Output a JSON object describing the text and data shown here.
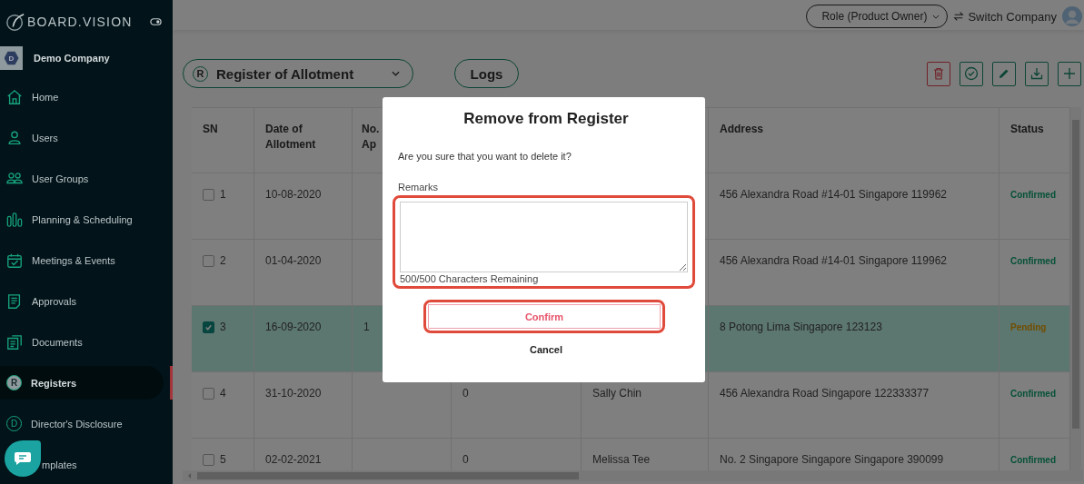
{
  "sidebar": {
    "brand": "BOARD.VISION",
    "company": {
      "badge": "D",
      "name": "Demo Company"
    },
    "items": [
      {
        "label": "Home",
        "kind": "home",
        "selected": false
      },
      {
        "label": "Users",
        "kind": "user",
        "selected": false
      },
      {
        "label": "User Groups",
        "kind": "users",
        "selected": false
      },
      {
        "label": "Planning & Scheduling",
        "kind": "bars",
        "selected": false
      },
      {
        "label": "Meetings & Events",
        "kind": "calendar",
        "selected": false
      },
      {
        "label": "Approvals",
        "kind": "document",
        "selected": false
      },
      {
        "label": "Documents",
        "kind": "documents",
        "selected": false
      },
      {
        "label": "Registers",
        "kind": "letter",
        "icon_letter": "R",
        "selected": true
      },
      {
        "label": "Director's Disclosure",
        "kind": "letter",
        "icon_letter": "D",
        "selected": false
      },
      {
        "label": "mplates",
        "kind": "covered",
        "selected": false
      }
    ]
  },
  "top_bar": {
    "role": "Role (Product Owner)",
    "switch_company": "Switch Company"
  },
  "register_select": {
    "badge": "R",
    "label": "Register of Allotment"
  },
  "logs_button": "Logs",
  "table": {
    "columns": [
      {
        "label": "SN"
      },
      {
        "label": "Date of Allotment"
      },
      {
        "label": "No. Ap"
      },
      {
        "label": "Address"
      },
      {
        "label": "Status"
      }
    ],
    "rows": [
      {
        "sn": "1",
        "checked": false,
        "selected": false,
        "date": "10-08-2020",
        "address": "456 Alexandra Road #14-01 Singapore 119962",
        "status": "Confirmed",
        "kind": "confirmed"
      },
      {
        "sn": "2",
        "checked": false,
        "selected": false,
        "date": "01-04-2020",
        "address": "456 Alexandra Road #14-01 Singapore 119962",
        "status": "Confirmed",
        "kind": "confirmed"
      },
      {
        "sn": "3",
        "checked": true,
        "selected": true,
        "date": "16-09-2020",
        "column_3": "1",
        "address": "8 Potong Lima Singapore 123123",
        "status": "Pending",
        "kind": "pending"
      },
      {
        "sn": "4",
        "checked": false,
        "selected": false,
        "date": "31-10-2020",
        "column_4": "0",
        "column_5": "Sally Chin",
        "address": "456 Alexandra Road Singapore 122333377",
        "status": "Confirmed",
        "kind": "confirmed"
      },
      {
        "sn": "5",
        "checked": false,
        "selected": false,
        "date": "02-02-2021",
        "column_4": "0",
        "column_5": "Melissa Tee",
        "address": "No. 2 Singapore Singapore Singapore 390099",
        "status": "Confirmed",
        "kind": "confirmed"
      }
    ]
  },
  "modal": {
    "title": "Remove from Register",
    "message": "Are you sure that you want to delete it?",
    "remarks_label": "Remarks",
    "remarks_counter": "500/500 Characters Remaining",
    "remarks_highlighted": true,
    "confirm": "Confirm",
    "confirm_highlighted": true,
    "cancel": "Cancel"
  }
}
